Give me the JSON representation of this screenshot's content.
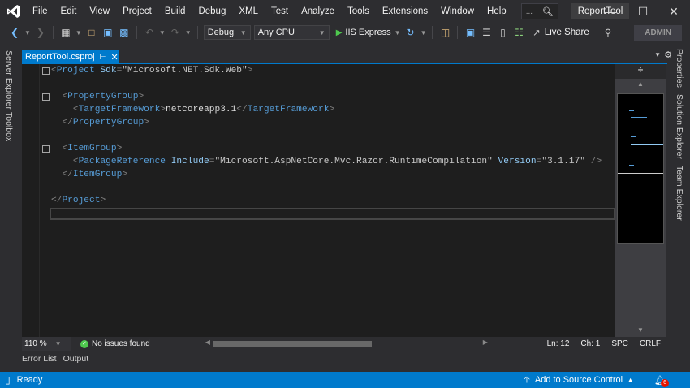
{
  "menu": [
    "File",
    "Edit",
    "View",
    "Project",
    "Build",
    "Debug",
    "XML",
    "Test",
    "Analyze",
    "Tools",
    "Extensions",
    "Window",
    "Help"
  ],
  "search": {
    "placeholder": "..."
  },
  "solution_title": "ReportTool",
  "toolbar": {
    "configuration": "Debug",
    "platform": "Any CPU",
    "run_label": "IIS Express",
    "live_share": "Live Share",
    "account": "ADMIN"
  },
  "left_tabs": [
    "Server Explorer",
    "Toolbox"
  ],
  "right_tabs": [
    "Properties",
    "Solution Explorer",
    "Team Explorer"
  ],
  "document_tab": {
    "label": "ReportTool.csproj"
  },
  "code_lines": [
    [
      [
        "d",
        "<"
      ],
      [
        "e",
        "Project"
      ],
      [
        "a",
        " Sdk"
      ],
      [
        "d",
        "="
      ],
      [
        "q",
        "\""
      ],
      [
        "s",
        "Microsoft.NET.Sdk.Web"
      ],
      [
        "q",
        "\""
      ],
      [
        "d",
        ">"
      ]
    ],
    [],
    [
      [
        "x",
        "  "
      ],
      [
        "d",
        "<"
      ],
      [
        "e",
        "PropertyGroup"
      ],
      [
        "d",
        ">"
      ]
    ],
    [
      [
        "x",
        "    "
      ],
      [
        "d",
        "<"
      ],
      [
        "e",
        "TargetFramework"
      ],
      [
        "d",
        ">"
      ],
      [
        "x",
        "netcoreapp3.1"
      ],
      [
        "d",
        "</"
      ],
      [
        "e",
        "TargetFramework"
      ],
      [
        "d",
        ">"
      ]
    ],
    [
      [
        "x",
        "  "
      ],
      [
        "d",
        "</"
      ],
      [
        "e",
        "PropertyGroup"
      ],
      [
        "d",
        ">"
      ]
    ],
    [],
    [
      [
        "x",
        "  "
      ],
      [
        "d",
        "<"
      ],
      [
        "e",
        "ItemGroup"
      ],
      [
        "d",
        ">"
      ]
    ],
    [
      [
        "x",
        "    "
      ],
      [
        "d",
        "<"
      ],
      [
        "e",
        "PackageReference"
      ],
      [
        "a",
        " Include"
      ],
      [
        "d",
        "="
      ],
      [
        "q",
        "\""
      ],
      [
        "s",
        "Microsoft.AspNetCore.Mvc.Razor.RuntimeCompilation"
      ],
      [
        "q",
        "\""
      ],
      [
        "a",
        " Version"
      ],
      [
        "d",
        "="
      ],
      [
        "q",
        "\""
      ],
      [
        "s",
        "3.1.17"
      ],
      [
        "q",
        "\""
      ],
      [
        "d",
        " />"
      ]
    ],
    [
      [
        "x",
        "  "
      ],
      [
        "d",
        "</"
      ],
      [
        "e",
        "ItemGroup"
      ],
      [
        "d",
        ">"
      ]
    ],
    [],
    [
      [
        "d",
        "</"
      ],
      [
        "e",
        "Project"
      ],
      [
        "d",
        ">"
      ]
    ]
  ],
  "editor_status": {
    "zoom": "110 %",
    "issues": "No issues found",
    "line": "Ln: 12",
    "col": "Ch: 1",
    "whitespace": "SPC",
    "line_ending": "CRLF"
  },
  "bottom_tabs": [
    "Error List",
    "Output"
  ],
  "statusbar": {
    "ready": "Ready",
    "source_control": "Add to Source Control",
    "notifications": "6"
  },
  "colors": {
    "accent": "#007acc",
    "editor_bg": "#1e1e1e",
    "chrome_bg": "#2d2d30"
  }
}
